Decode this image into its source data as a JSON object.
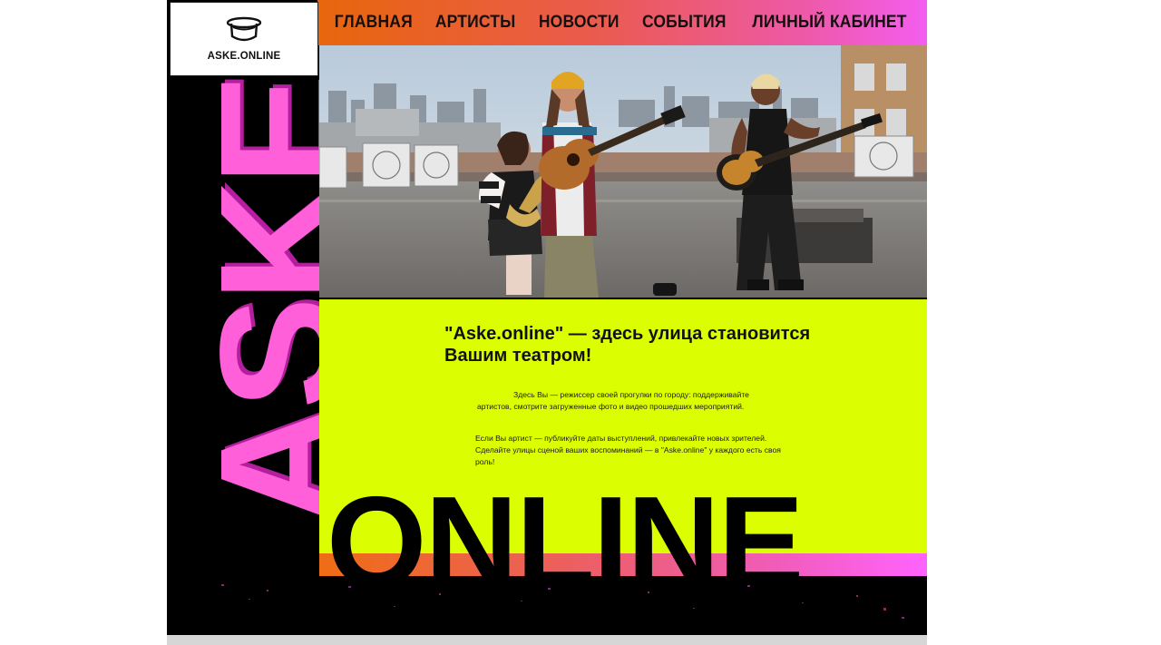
{
  "logo": {
    "text": "ASKE.ONLINE",
    "icon": "hat-icon"
  },
  "nav": {
    "items": [
      {
        "id": "home",
        "label": "ГЛАВНАЯ"
      },
      {
        "id": "artists",
        "label": "АРТИСТЫ"
      },
      {
        "id": "news",
        "label": "НОВОСТИ"
      },
      {
        "id": "events",
        "label": "СОБЫТИЯ"
      },
      {
        "id": "account",
        "label": "ЛИЧНЫЙ КАБИНЕТ"
      }
    ]
  },
  "hero": {
    "alt": "Musicians playing on a rooftop"
  },
  "decor": {
    "vertical": "ASKE",
    "bottom": "ONLINE"
  },
  "intro": {
    "headline_line1": "\"Aske.online\" — здесь улица становится",
    "headline_line2": "Вашим театром!",
    "para1": "Здесь Вы — режиссер своей прогулки по городу: поддерживайте артистов, смотрите загруженные фото и видео прошедших мероприятий.",
    "para2": "Если Вы артист — публикуйте даты выступлений, привлекайте новых зрителей. Сделайте улицы сценой ваших воспоминаний — в \"Aske.online\" у каждого есть своя роль!"
  },
  "colors": {
    "lime": "#dbff00",
    "pink": "#ff5fd9",
    "orange": "#e8660c",
    "black": "#000000"
  }
}
